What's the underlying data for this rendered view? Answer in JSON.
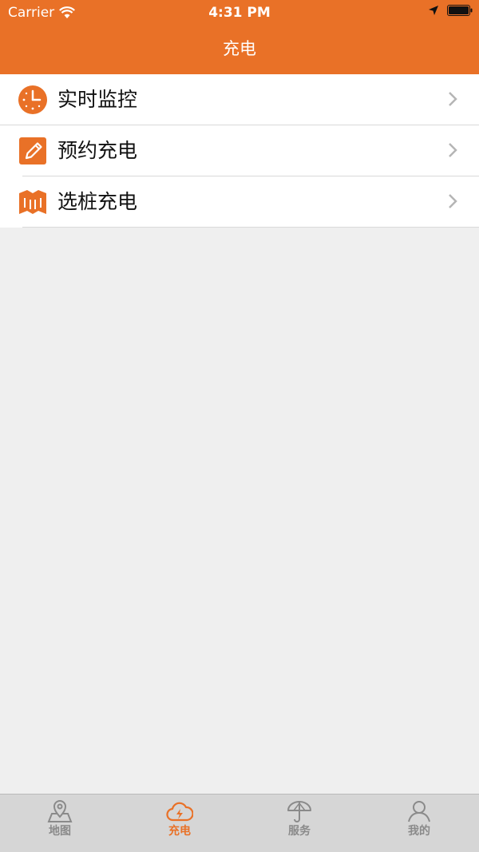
{
  "status_bar": {
    "carrier": "Carrier",
    "time": "4:31 PM"
  },
  "header": {
    "title": "充电"
  },
  "menu": {
    "items": [
      {
        "label": "实时监控",
        "icon": "clock-icon"
      },
      {
        "label": "预约充电",
        "icon": "edit-icon"
      },
      {
        "label": "选桩充电",
        "icon": "map-icon"
      }
    ]
  },
  "tab_bar": {
    "active": 1,
    "tabs": [
      {
        "label": "地图",
        "icon": "map-pin-icon"
      },
      {
        "label": "充电",
        "icon": "charging-cloud-icon"
      },
      {
        "label": "服务",
        "icon": "umbrella-icon"
      },
      {
        "label": "我的",
        "icon": "user-icon"
      }
    ]
  },
  "colors": {
    "accent": "#e97127",
    "background": "#efefef",
    "tab_inactive": "#8a8a8a"
  }
}
